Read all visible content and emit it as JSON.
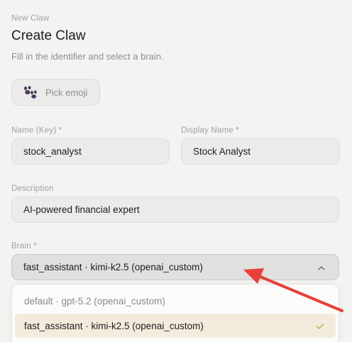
{
  "header": {
    "eyebrow": "New Claw",
    "title": "Create Claw",
    "subtitle": "Fill in the identifier and select a brain."
  },
  "emoji": {
    "label": "Pick emoji",
    "icon": "paw-prints-icon"
  },
  "fields": {
    "name": {
      "label": "Name (Key) *",
      "value": "stock_analyst"
    },
    "display_name": {
      "label": "Display Name *",
      "value": "Stock Analyst"
    },
    "description": {
      "label": "Description",
      "value": "AI-powered financial expert"
    }
  },
  "brain": {
    "label": "Brain *",
    "selected": "fast_assistant · kimi-k2.5 (openai_custom)",
    "options": [
      {
        "label": "default · gpt-5.2 (openai_custom)",
        "selected": false
      },
      {
        "label": "fast_assistant · kimi-k2.5 (openai_custom)",
        "selected": true
      }
    ]
  },
  "colors": {
    "annotation_arrow": "#e8403a",
    "selected_option_bg": "#f3ecdd",
    "check_color": "#c9a04a"
  }
}
